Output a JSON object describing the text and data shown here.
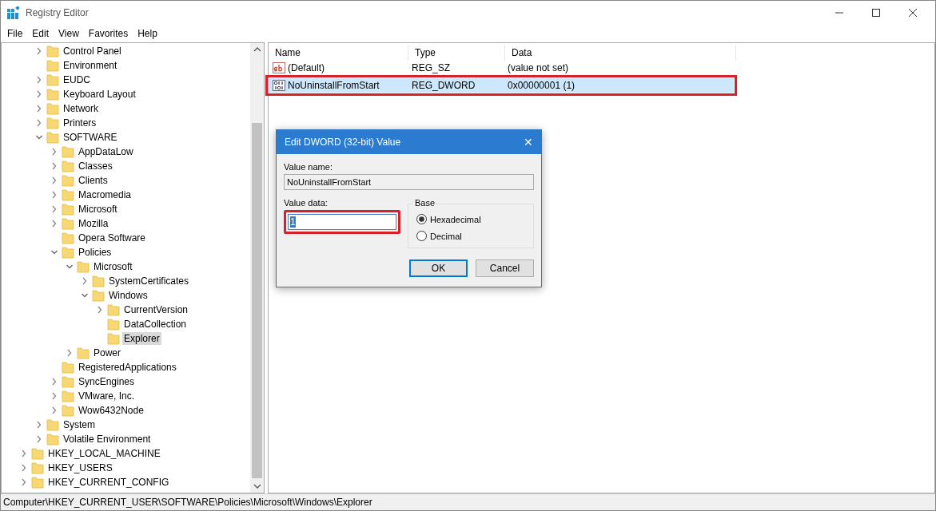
{
  "window": {
    "title": "Registry Editor"
  },
  "menu": [
    "File",
    "Edit",
    "View",
    "Favorites",
    "Help"
  ],
  "tree": {
    "scrolled_items": [
      {
        "label": "Control Panel",
        "kind": "folder",
        "expanded": false,
        "selected": false
      },
      {
        "label": "Environment",
        "kind": "leaf",
        "selected": false
      },
      {
        "label": "EUDC",
        "kind": "folder",
        "expanded": false,
        "selected": false
      },
      {
        "label": "Keyboard Layout",
        "kind": "folder",
        "expanded": false,
        "selected": false
      },
      {
        "label": "Network",
        "kind": "folder",
        "expanded": false,
        "selected": false
      },
      {
        "label": "Printers",
        "kind": "folder",
        "expanded": false,
        "selected": false
      },
      {
        "label": "SOFTWARE",
        "kind": "folder",
        "expanded": true,
        "selected": false,
        "children": [
          {
            "label": "AppDataLow",
            "kind": "folder",
            "expanded": false,
            "selected": false
          },
          {
            "label": "Classes",
            "kind": "folder",
            "expanded": false,
            "selected": false
          },
          {
            "label": "Clients",
            "kind": "folder",
            "expanded": false,
            "selected": false
          },
          {
            "label": "Macromedia",
            "kind": "folder",
            "expanded": false,
            "selected": false
          },
          {
            "label": "Microsoft",
            "kind": "folder",
            "expanded": false,
            "selected": false
          },
          {
            "label": "Mozilla",
            "kind": "folder",
            "expanded": false,
            "selected": false
          },
          {
            "label": "Opera Software",
            "kind": "leaf",
            "selected": false
          },
          {
            "label": "Policies",
            "kind": "folder",
            "expanded": true,
            "selected": false,
            "children": [
              {
                "label": "Microsoft",
                "kind": "folder",
                "expanded": true,
                "selected": false,
                "children": [
                  {
                    "label": "SystemCertificates",
                    "kind": "folder",
                    "expanded": false,
                    "selected": false
                  },
                  {
                    "label": "Windows",
                    "kind": "folder",
                    "expanded": true,
                    "selected": false,
                    "children": [
                      {
                        "label": "CurrentVersion",
                        "kind": "folder",
                        "expanded": false,
                        "selected": false
                      },
                      {
                        "label": "DataCollection",
                        "kind": "leaf",
                        "selected": false
                      },
                      {
                        "label": "Explorer",
                        "kind": "leaf",
                        "selected": true
                      }
                    ]
                  }
                ]
              },
              {
                "label": "Power",
                "kind": "folder",
                "expanded": false,
                "selected": false
              }
            ]
          },
          {
            "label": "RegisteredApplications",
            "kind": "leaf",
            "selected": false
          },
          {
            "label": "SyncEngines",
            "kind": "folder",
            "expanded": false,
            "selected": false
          },
          {
            "label": "VMware, Inc.",
            "kind": "folder",
            "expanded": false,
            "selected": false
          },
          {
            "label": "Wow6432Node",
            "kind": "folder",
            "expanded": false,
            "selected": false
          }
        ]
      },
      {
        "label": "System",
        "kind": "folder",
        "expanded": false,
        "selected": false
      },
      {
        "label": "Volatile Environment",
        "kind": "folder",
        "expanded": false,
        "selected": false
      }
    ],
    "items": [
      {
        "label": "HKEY_LOCAL_MACHINE",
        "kind": "folder",
        "expanded": false,
        "selected": false
      },
      {
        "label": "HKEY_USERS",
        "kind": "folder",
        "expanded": false,
        "selected": false
      },
      {
        "label": "HKEY_CURRENT_CONFIG",
        "kind": "folder",
        "expanded": false,
        "selected": false
      }
    ]
  },
  "table": {
    "columns": [
      "Name",
      "Type",
      "Data"
    ],
    "rows": [
      {
        "kind": "string",
        "name": "(Default)",
        "type": "REG_SZ",
        "data": "(value not set)",
        "selected": false,
        "highlighted": false
      },
      {
        "kind": "binary",
        "name": "NoUninstallFromStart",
        "type": "REG_DWORD",
        "data": "0x00000001 (1)",
        "selected": true,
        "highlighted": true
      }
    ]
  },
  "dialog": {
    "title": "Edit DWORD (32-bit) Value",
    "close": "✕",
    "value_name_label": "Value name:",
    "value_name": "NoUninstallFromStart",
    "value_data_label": "Value data:",
    "value_data": "1",
    "value_data_highlighted": true,
    "base_label": "Base",
    "base_options": [
      {
        "label": "Hexadecimal",
        "selected": true
      },
      {
        "label": "Decimal",
        "selected": false
      }
    ],
    "buttons": [
      {
        "label": "OK",
        "default": true
      },
      {
        "label": "Cancel",
        "default": false
      }
    ]
  },
  "status_bar": "Computer\\HKEY_CURRENT_USER\\SOFTWARE\\Policies\\Microsoft\\Windows\\Explorer"
}
